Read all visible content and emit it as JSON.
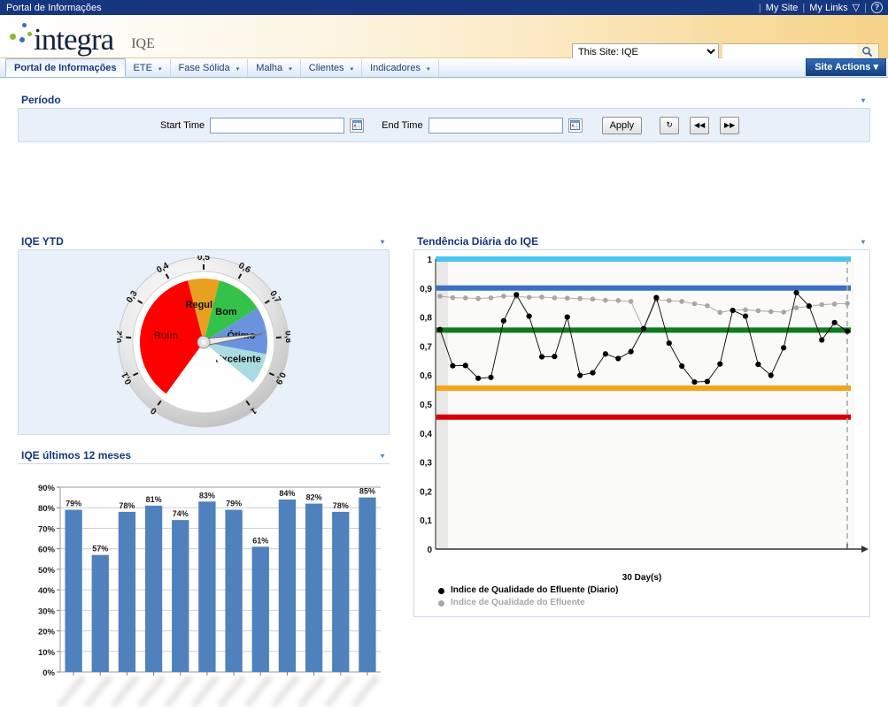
{
  "topbar": {
    "site_name": "Portal de Informações",
    "links": [
      "My Site",
      "My Links"
    ],
    "my_links_caret": "▽",
    "help_icon": "?"
  },
  "header": {
    "logo_text": "integra",
    "site_title": "IQE",
    "search": {
      "scope_selected": "This Site: IQE",
      "scope_options": [
        "This Site: IQE"
      ],
      "query_value": "",
      "query_placeholder": "",
      "go_icon": "search-icon"
    }
  },
  "nav": {
    "tabs": [
      {
        "label": "Portal de Informações",
        "has_caret": false,
        "active": true
      },
      {
        "label": "ETE",
        "has_caret": true,
        "active": false
      },
      {
        "label": "Fase Sólida",
        "has_caret": true,
        "active": false
      },
      {
        "label": "Malha",
        "has_caret": true,
        "active": false
      },
      {
        "label": "Clientes",
        "has_caret": true,
        "active": false
      },
      {
        "label": "Indicadores",
        "has_caret": true,
        "active": false
      }
    ],
    "site_actions": "Site Actions",
    "site_actions_caret": "▾"
  },
  "periodo": {
    "title": "Período",
    "menu_caret": "▾",
    "start_label": "Start Time",
    "start_value": "",
    "end_label": "End Time",
    "end_value": "",
    "apply_label": "Apply",
    "refresh_icon": "↻",
    "prev_icon": "◀◀",
    "next_icon": "▶▶"
  },
  "panels": {
    "ytd_title": "IQE YTD",
    "trend_title": "Tendência Diária do IQE",
    "bars_title": "IQE últimos 12 meses",
    "menu_caret": "▾"
  },
  "chart_data": [
    {
      "type": "gauge",
      "title": "IQE YTD",
      "value": 0.785,
      "min": 0,
      "max": 1,
      "tick_labels": [
        "0",
        "0,1",
        "0,2",
        "0,3",
        "0,4",
        "0,5",
        "0,6",
        "0,7",
        "0,8",
        "0,9",
        "1"
      ],
      "bands": [
        {
          "label": "Ruim",
          "from": 0.0,
          "to": 0.45,
          "color": "#fe0000"
        },
        {
          "label": "Regular",
          "from": 0.45,
          "to": 0.55,
          "color": "#e8a020"
        },
        {
          "label": "Bom",
          "from": 0.55,
          "to": 0.7,
          "color": "#35c24a"
        },
        {
          "label": "Ótimo",
          "from": 0.7,
          "to": 0.85,
          "color": "#6b93dd"
        },
        {
          "label": "Excelente",
          "from": 0.85,
          "to": 0.95,
          "color": "#aadbe0"
        },
        {
          "label": "",
          "from": 0.95,
          "to": 1.0,
          "color": "#ffffff"
        }
      ]
    },
    {
      "type": "bar",
      "title": "IQE últimos 12 meses",
      "categories": [
        "",
        "",
        "",
        "",
        "",
        "",
        "",
        "",
        "",
        "",
        "",
        ""
      ],
      "values": [
        79,
        57,
        78,
        81,
        74,
        83,
        79,
        61,
        84,
        82,
        78,
        85
      ],
      "data_labels": [
        "79%",
        "57%",
        "78%",
        "81%",
        "74%",
        "83%",
        "79%",
        "61%",
        "84%",
        "82%",
        "78%",
        "85%"
      ],
      "ylabel": "",
      "xlabel": "",
      "ylim": [
        0,
        90
      ],
      "ytick_labels": [
        "0%",
        "10%",
        "20%",
        "30%",
        "40%",
        "50%",
        "60%",
        "70%",
        "80%",
        "90%"
      ],
      "bar_color": "#4f81bd",
      "grid": true,
      "legend": "none",
      "xtick_labels_blurred": true
    },
    {
      "type": "line",
      "title": "Tendência Diária do IQE",
      "xlabel": "30 Day(s)",
      "ylabel": "",
      "ylim": [
        0,
        1
      ],
      "ytick_labels": [
        "0",
        "0,1",
        "0,2",
        "0,3",
        "0,4",
        "0,5",
        "0,6",
        "0,7",
        "0,8",
        "0,9",
        "1"
      ],
      "grid": false,
      "legend_position": "bottom-left",
      "series": [
        {
          "name": "Indice de Qualidade do Efluente (Diario)",
          "color": "#000000",
          "values": [
            0.757,
            0.632,
            0.633,
            0.589,
            0.592,
            0.787,
            0.877,
            0.803,
            0.663,
            0.664,
            0.8,
            0.599,
            0.608,
            0.673,
            0.657,
            0.681,
            0.76,
            0.867,
            0.71,
            0.631,
            0.576,
            0.578,
            0.638,
            0.823,
            0.803,
            0.637,
            0.599,
            0.694,
            0.884,
            0.838,
            0.721,
            0.781,
            0.751
          ]
        },
        {
          "name": "Indice de Qualidade do Efluente",
          "color": "#a6a6a6",
          "values": [
            0.872,
            0.867,
            0.866,
            0.864,
            0.866,
            0.872,
            0.871,
            0.868,
            0.869,
            0.866,
            0.865,
            0.864,
            0.862,
            0.858,
            0.857,
            0.854,
            0.759,
            0.86,
            0.857,
            0.854,
            0.846,
            0.839,
            0.816,
            0.824,
            0.825,
            0.822,
            0.819,
            0.817,
            0.832,
            0.837,
            0.843,
            0.845,
            0.847
          ]
        }
      ],
      "threshold_lines": [
        {
          "value": 1.0,
          "color": "#4cc5ef",
          "name": "excelente-limit"
        },
        {
          "value": 0.9,
          "color": "#3a6fc4",
          "name": "otimo-limit"
        },
        {
          "value": 0.755,
          "color": "#0f7a1e",
          "name": "bom-limit"
        },
        {
          "value": 0.555,
          "color": "#f9a319",
          "name": "regular-limit"
        },
        {
          "value": 0.455,
          "color": "#d60000",
          "name": "ruim-limit"
        }
      ]
    }
  ]
}
